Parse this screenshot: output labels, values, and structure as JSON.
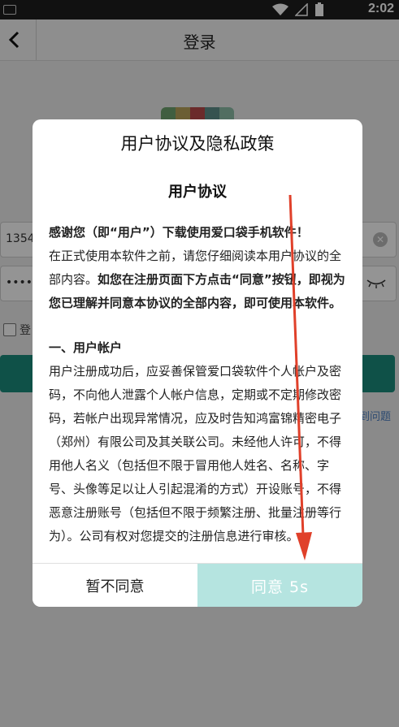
{
  "status_bar": {
    "time": "2:02"
  },
  "header": {
    "title": "登录"
  },
  "login": {
    "phone_value": "1354",
    "password_value": "••••••",
    "remember_label": "登",
    "help_text": "到问题",
    "brand_colors": [
      "#6ea36e",
      "#b9a35a",
      "#b94b4b",
      "#5e8f8a",
      "#8dbda8"
    ]
  },
  "dialog": {
    "title": "用户协议及隐私政策",
    "subtitle": "用户协议",
    "para1_bold": "感谢您（即“用户”）下载使用爱口袋手机软件！",
    "para1_normal": "在正式使用本软件之前，请您仔细阅读本用户协议的全部内容。",
    "para1_bold2": "如您在注册页面下方点击“同意”按钮，即视为您已理解并同意本协议的全部内容，即可使用本软件。",
    "section1_heading": "一、用户帐户",
    "section1_text": "用户注册成功后，应妥善保管爱口袋软件个人帐户及密码，不向他人泄露个人帐户信息，定期或不定期修改密码，若帐户出现异常情况，应及时告知鸿富锦精密电子（郑州）有限公司及其关联公司。未经他人许可，不得用他人名义（包括但不限于冒用他人姓名、名称、字号、头像等足以让人引起混淆的方式）开设账号，不得恶意注册账号（包括但不限于频繁注册、批量注册等行为）。公司有权对您提交的注册信息进行审核。",
    "disagree_label": "暂不同意",
    "agree_label": "同意  5s"
  },
  "colors": {
    "accent": "#1b8c7d",
    "agree_button": "#b5e4e0",
    "arrow": "#e0402a"
  }
}
